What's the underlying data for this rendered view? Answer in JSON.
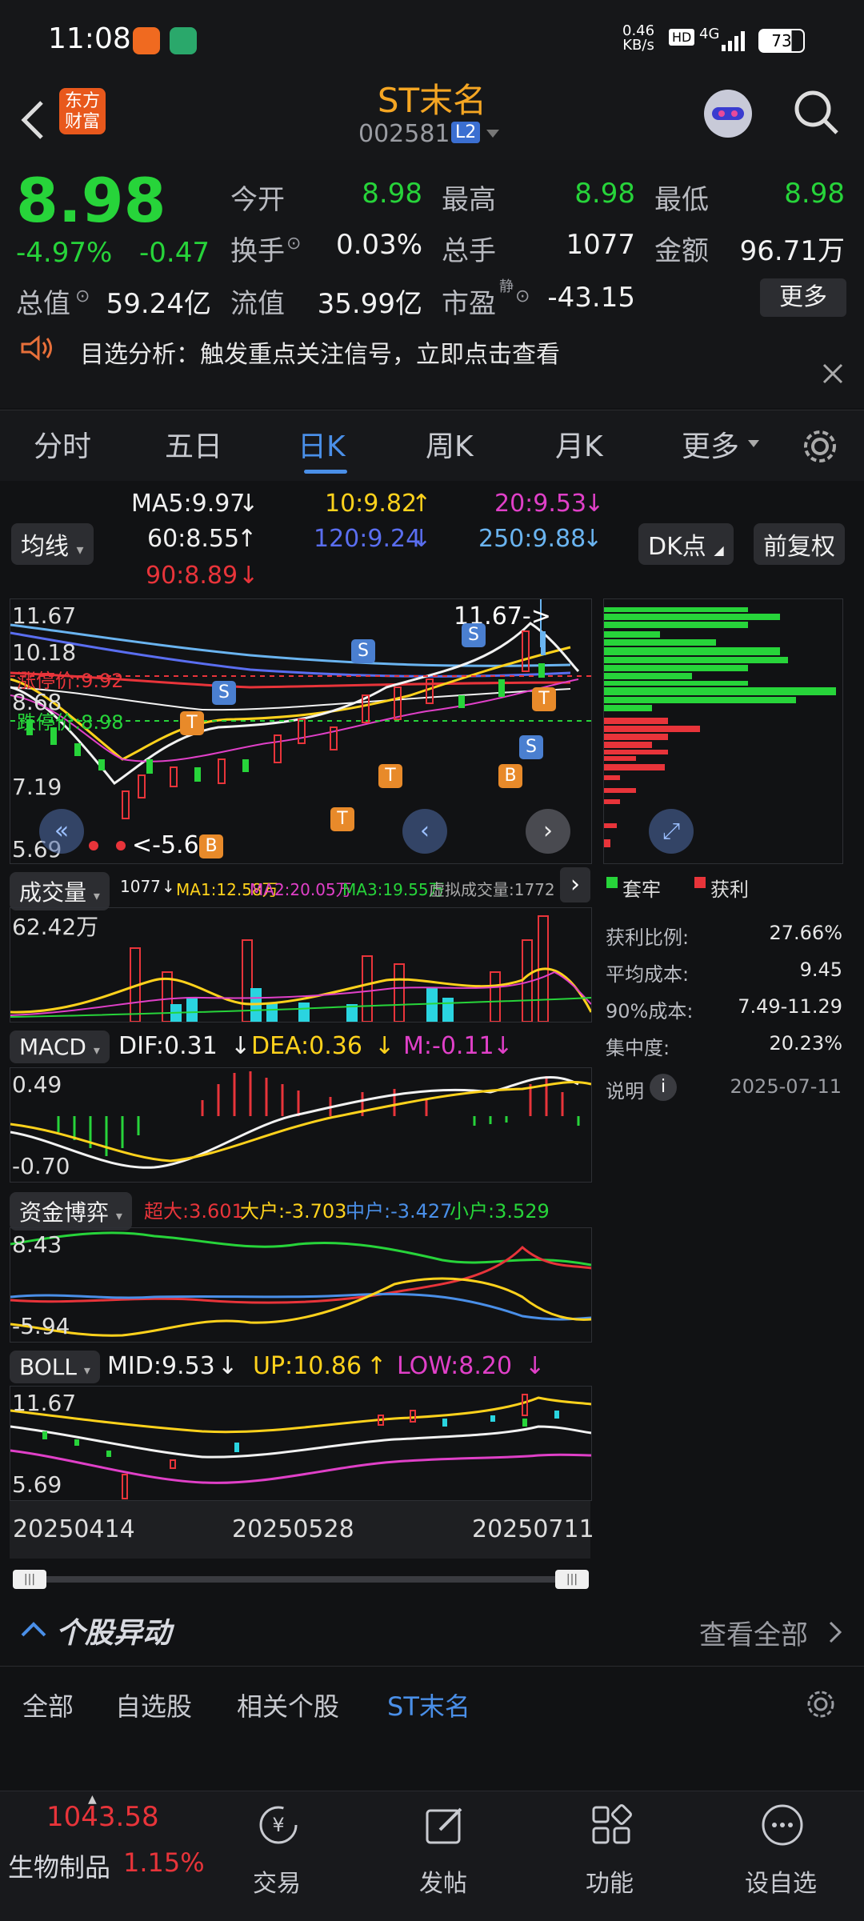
{
  "status_bar": {
    "time": "11:08",
    "net_speed_top": "0.46",
    "net_speed_bottom": "KB/s",
    "hd": "HD",
    "net_type": "4G",
    "battery": "73"
  },
  "header": {
    "back_icon": "chevron-left-icon",
    "logo_text_1": "东方",
    "logo_text_2": "财富",
    "stock_name": "ST末名",
    "stock_code": "002581",
    "level_badge": "L2",
    "search_icon": "search-icon"
  },
  "quote": {
    "price": "8.98",
    "change_pct": "-4.97%",
    "change_amt": "-0.47",
    "open_label": "今开",
    "open_value": "8.98",
    "high_label": "最高",
    "high_value": "8.98",
    "low_label": "最低",
    "low_value": "8.98",
    "turnover_label": "换手",
    "turnover_value": "0.03%",
    "volume_label": "总手",
    "volume_value": "1077",
    "amount_label": "金额",
    "amount_value": "96.71万",
    "mktcap_label": "总值",
    "mktcap_value": "59.24亿",
    "float_label": "流值",
    "float_value": "35.99亿",
    "pe_label": "市盈",
    "pe_sup": "静",
    "pe_value": "-43.15",
    "more_button": "更多"
  },
  "notice": {
    "text": "目选分析：触发重点关注信号，立即点击查看"
  },
  "tabs": {
    "items": [
      "分时",
      "五日",
      "日K",
      "周K",
      "月K",
      "更多"
    ],
    "active": "日K"
  },
  "ma": {
    "ma5": "MA5:9.97",
    "ma10": "10:9.82",
    "ma20": "20:9.53",
    "ma60": "60:8.55",
    "ma120": "120:9.24",
    "ma250": "250:9.88",
    "ma90": "90:8.89",
    "junxian": "均线",
    "dk_button": "DK点",
    "fq_button": "前复权"
  },
  "kline": {
    "y_top": "11.67",
    "y_2": "10.18",
    "y_3": "8.68",
    "y_4": "7.19",
    "y_bottom": "5.69",
    "high_marker": "11.67->",
    "low_marker": "<-5.6",
    "limit_up": "涨停价:9.92",
    "limit_down": "跌停价:8.98",
    "chip_legend_1": "套牢",
    "chip_legend_2": "获利"
  },
  "chip_stats": {
    "profit_ratio_label": "获利比例:",
    "profit_ratio_value": "27.66%",
    "avg_cost_label": "平均成本:",
    "avg_cost_value": "9.45",
    "cost90_label": "90%成本:",
    "cost90_value": "7.49-11.29",
    "concentration_label": "集中度:",
    "concentration_value": "20.23%",
    "note_label": "说明",
    "date": "2025-07-11"
  },
  "volume": {
    "title": "成交量",
    "v": "1077",
    "ma1": "MA1:12.58万",
    "ma2": "MA2:20.05万",
    "ma3": "MA3:19.55万",
    "virtual": "虚拟成交量:1772",
    "y_top": "62.42万"
  },
  "macd": {
    "title": "MACD",
    "dif": "DIF:0.31",
    "dea": "DEA:0.36",
    "m": "M:-0.11",
    "y_top": "0.49",
    "y_bottom": "-0.70"
  },
  "fund": {
    "title": "资金博弈",
    "super": "超大:3.601",
    "large": "大户:-3.703",
    "mid": "中户:-3.427",
    "small": "小户:3.529",
    "y_top": "8.43",
    "y_bottom": "-5.94"
  },
  "boll": {
    "title": "BOLL",
    "mid": "MID:9.53",
    "up": "UP:10.86",
    "low": "LOW:8.20",
    "y_top": "11.67",
    "y_bottom": "5.69"
  },
  "dates": [
    "20250414",
    "20250528",
    "20250711"
  ],
  "movers": {
    "title": "个股异动",
    "view_all": "查看全部",
    "filters": [
      "全部",
      "自选股",
      "相关个股",
      "ST末名"
    ]
  },
  "bottom_nav": {
    "index_value": "1043.58",
    "index_name": "生物制品",
    "index_change": "1.15%",
    "items": [
      "交易",
      "发帖",
      "功能",
      "设自选"
    ]
  },
  "colors": {
    "green": "#27d43a",
    "red": "#e8343a",
    "accent_orange": "#f5a623",
    "blue_active": "#4a8fe8"
  }
}
